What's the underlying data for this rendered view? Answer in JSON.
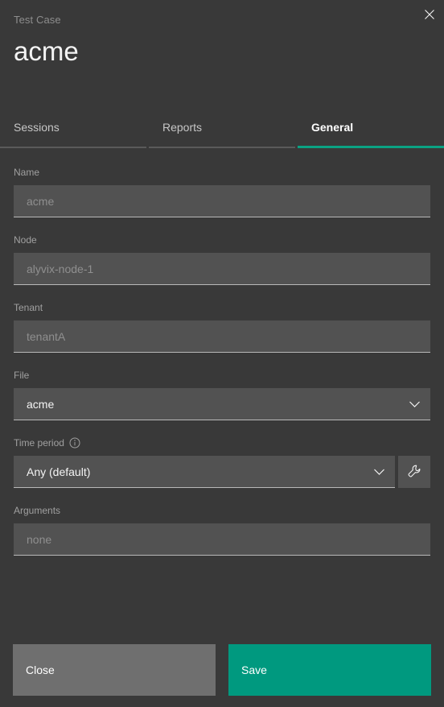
{
  "modal": {
    "eyebrow": "Test Case",
    "title": "acme",
    "close_icon": "close-icon"
  },
  "tabs": [
    {
      "label": "Sessions",
      "active": false
    },
    {
      "label": "Reports",
      "active": false
    },
    {
      "label": "General",
      "active": true
    }
  ],
  "form": {
    "name": {
      "label": "Name",
      "value": "",
      "placeholder": "acme"
    },
    "node": {
      "label": "Node",
      "value": "",
      "placeholder": "alyvix-node-1"
    },
    "tenant": {
      "label": "Tenant",
      "value": "",
      "placeholder": "tenantA"
    },
    "file": {
      "label": "File",
      "selected": "acme",
      "icon": "chevron-down-icon"
    },
    "time_period": {
      "label": "Time period",
      "info_icon": "info-icon",
      "selected": "Any (default)",
      "icon": "chevron-down-icon",
      "tool_icon": "wrench-icon"
    },
    "arguments": {
      "label": "Arguments",
      "value": "",
      "placeholder": "none"
    }
  },
  "footer": {
    "close_label": "Close",
    "save_label": "Save"
  },
  "colors": {
    "background": "#393939",
    "field": "#525252",
    "accent": "#00997f",
    "tab_active": "#0aa283",
    "secondary_button": "#6f6f6f"
  }
}
